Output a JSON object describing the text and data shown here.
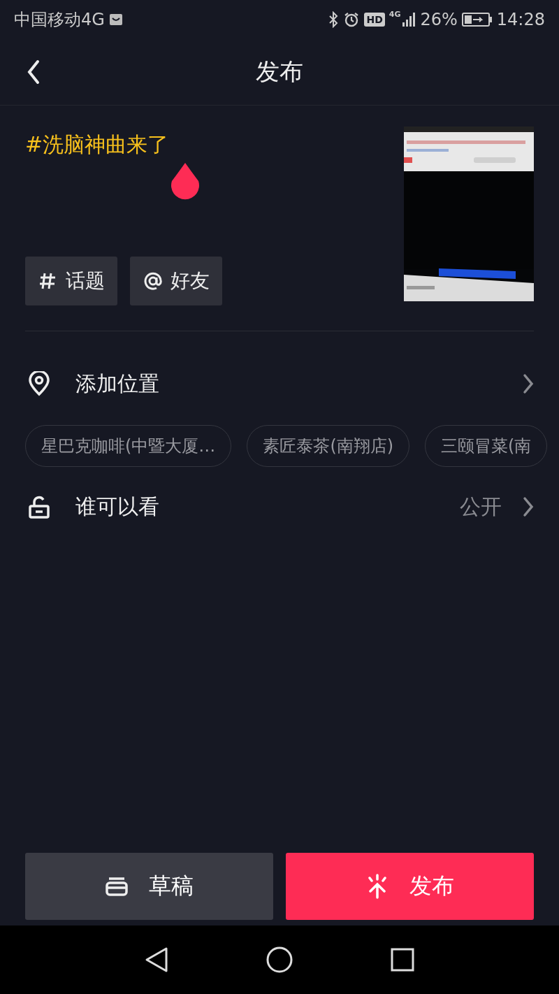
{
  "status_bar": {
    "carrier": "中国移动4G",
    "hd": "HD",
    "network": "4G",
    "battery": "26%",
    "time": "14:28"
  },
  "header": {
    "title": "发布"
  },
  "caption": {
    "value": "#洗脑神曲来了"
  },
  "tag_buttons": [
    {
      "kind": "hashtag",
      "label": "话题"
    },
    {
      "kind": "mention",
      "label": "好友"
    }
  ],
  "location": {
    "label": "添加位置"
  },
  "location_chips": [
    "星巴克咖啡(中暨大厦…",
    "素匠泰茶(南翔店)",
    "三颐冒菜(南"
  ],
  "visibility": {
    "label": "谁可以看",
    "value": "公开"
  },
  "actions": [
    {
      "kind": "draft",
      "label": "草稿"
    },
    {
      "kind": "publish",
      "label": "发布"
    }
  ]
}
